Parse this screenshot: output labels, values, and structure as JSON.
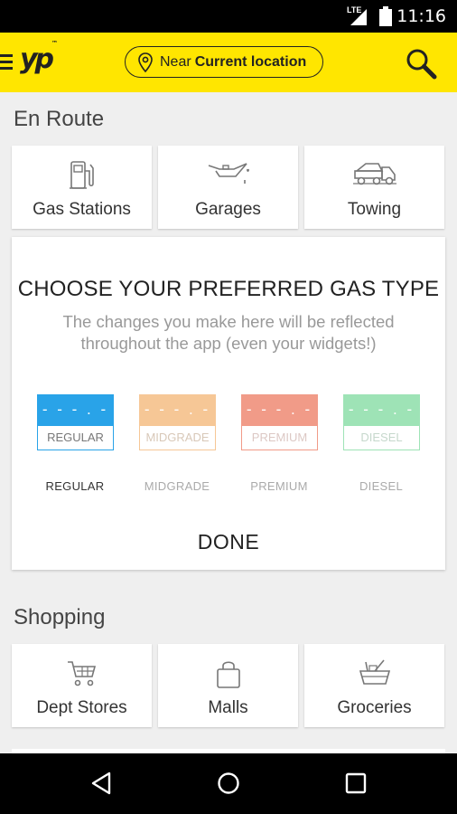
{
  "status_bar": {
    "network": "LTE",
    "time": "11:16"
  },
  "app_bar": {
    "logo": "yp",
    "logo_mark": "™",
    "location_prefix": "Near",
    "location_value": "Current location"
  },
  "en_route": {
    "title": "En Route",
    "tiles": [
      {
        "label": "Gas Stations",
        "icon": "gas-pump-icon"
      },
      {
        "label": "Garages",
        "icon": "oil-can-icon"
      },
      {
        "label": "Towing",
        "icon": "tow-truck-icon"
      }
    ]
  },
  "gas_dialog": {
    "title": "CHOOSE YOUR PREFERRED GAS TYPE",
    "description": "The changes you make here will be reflected throughout the app (even your widgets!)",
    "options": [
      {
        "price": "- - - . -",
        "name": "REGULAR",
        "label": "REGULAR",
        "color": "#29a3e8",
        "selected": true
      },
      {
        "price": "- - - . -",
        "name": "MIDGRADE",
        "label": "MIDGRADE",
        "color": "#f6c796",
        "selected": false
      },
      {
        "price": "- - - . -",
        "name": "PREMIUM",
        "label": "PREMIUM",
        "color": "#f19b88",
        "selected": false
      },
      {
        "price": "- - - . -",
        "name": "DIESEL",
        "label": "DIESEL",
        "color": "#9ee3b6",
        "selected": false
      }
    ],
    "done_label": "DONE"
  },
  "shopping": {
    "title": "Shopping",
    "tiles": [
      {
        "label": "Dept Stores",
        "icon": "shopping-cart-icon"
      },
      {
        "label": "Malls",
        "icon": "shopping-bag-icon"
      },
      {
        "label": "Groceries",
        "icon": "grocery-basket-icon"
      }
    ]
  }
}
